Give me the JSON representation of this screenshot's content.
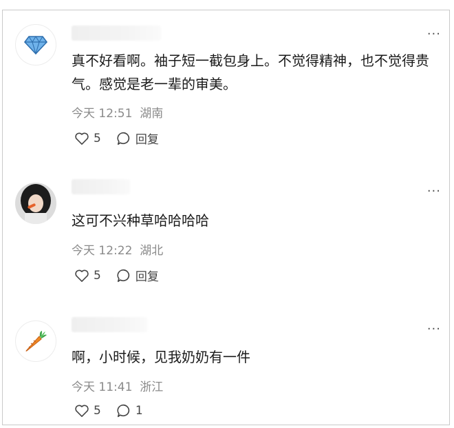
{
  "comments": [
    {
      "avatar_icon": "diamond-icon",
      "text": "真不好看啊。袖子短一截包身上。不觉得精神，也不觉得贵气。感觉是老一辈的审美。",
      "date": "今天 12:51",
      "location": "湖南",
      "likes": "5",
      "reply": "回复"
    },
    {
      "avatar_icon": "user-photo",
      "text": "这可不兴种草哈哈哈哈",
      "date": "今天 12:22",
      "location": "湖北",
      "likes": "5",
      "reply": "回复"
    },
    {
      "avatar_icon": "carrot-icon",
      "text": "啊，小时候，见我奶奶有一件",
      "date": "今天 11:41",
      "location": "浙江",
      "likes": "5",
      "reply": "1"
    }
  ],
  "more_label": "···"
}
